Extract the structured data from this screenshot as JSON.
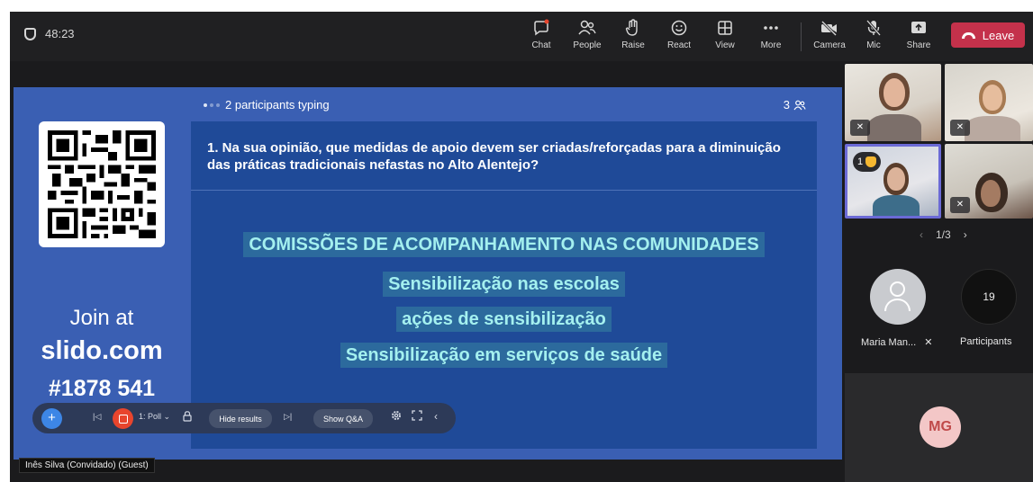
{
  "meeting": {
    "timer": "48:23",
    "toolbar": [
      {
        "key": "chat",
        "label": "Chat",
        "icon": "chat-icon"
      },
      {
        "key": "people",
        "label": "People",
        "icon": "people-icon"
      },
      {
        "key": "raise",
        "label": "Raise",
        "icon": "raise-hand-icon"
      },
      {
        "key": "react",
        "label": "React",
        "icon": "smiley-icon"
      },
      {
        "key": "view",
        "label": "View",
        "icon": "grid-view-icon"
      },
      {
        "key": "more",
        "label": "More",
        "icon": "more-dots-icon"
      },
      {
        "key": "camera",
        "label": "Camera",
        "icon": "camera-off-icon"
      },
      {
        "key": "mic",
        "label": "Mic",
        "icon": "mic-off-icon"
      },
      {
        "key": "share",
        "label": "Share",
        "icon": "share-icon"
      }
    ],
    "leave_label": "Leave"
  },
  "slido": {
    "join_line1": "Join at",
    "join_line2": "slido.com",
    "join_line3": "#1878 541",
    "typing": "2 participants typing",
    "participant_count": "3",
    "question": "1. Na sua opinião, que medidas de apoio devem ser criadas/reforçadas para a diminuição das práticas tradicionais nefastas no Alto Alentejo?",
    "answers": [
      "COMISSÕES DE ACOMPANHAMENTO NAS COMUNIDADES",
      "Sensibilização nas escolas",
      "ações de sensibilização",
      "Sensibilização em serviços de saúde"
    ]
  },
  "presenter_toolbar": {
    "poll_label": "1: Poll",
    "hide_results": "Hide results",
    "show_qa": "Show Q&A"
  },
  "presenter_name": "Inês Silva (Convidado) (Guest)",
  "participants": {
    "raise_number": "1",
    "pager": "1/3",
    "person_name": "Maria Man...",
    "participants_count": "19",
    "participants_label": "Participants",
    "mg_initials": "MG"
  },
  "colors": {
    "leave": "#c4314b",
    "slido_bg": "#3a5fb3",
    "slido_panel": "#1f4a98",
    "answer_text": "#a4f0ef",
    "answer_bg": "#2c6a9d",
    "mg_avatar": "#f3c7c7",
    "selected_border": "#6b6ad6"
  }
}
